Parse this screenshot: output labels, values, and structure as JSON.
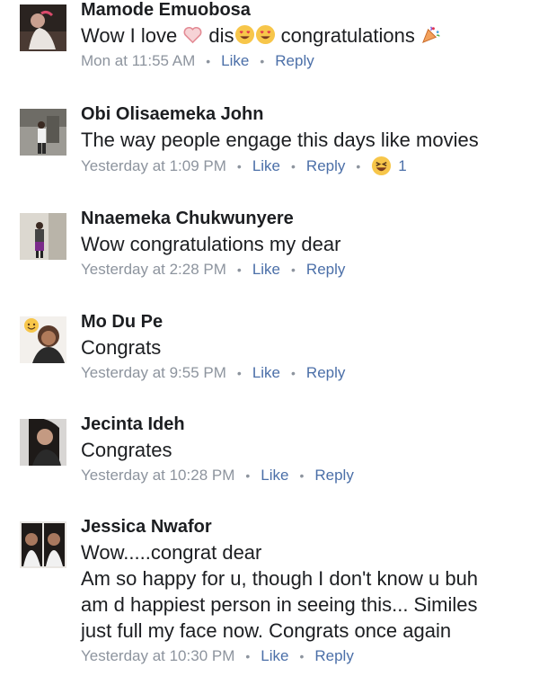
{
  "comments": [
    {
      "name": "Mamode Emuobosa",
      "text_parts": [
        "Wow I love ",
        " dis",
        " congratulations "
      ],
      "time": "Mon at 11:55 AM",
      "like": "Like",
      "reply": "Reply",
      "emoji": [
        "heart-icon",
        "heart-eyes-icon",
        "heart-eyes-icon",
        "party-popper-icon"
      ]
    },
    {
      "name": "Obi Olisaemeka John",
      "text": "The way people engage this days like movies",
      "time": "Yesterday at 1:09 PM",
      "like": "Like",
      "reply": "Reply",
      "reaction_icon": "laughing-icon",
      "reaction_count": "1"
    },
    {
      "name": "Nnaemeka Chukwunyere",
      "text": "Wow congratulations my dear",
      "time": "Yesterday at 2:28 PM",
      "like": "Like",
      "reply": "Reply"
    },
    {
      "name": "Mo Du Pe",
      "text": "Congrats",
      "time": "Yesterday at 9:55 PM",
      "like": "Like",
      "reply": "Reply"
    },
    {
      "name": "Jecinta Ideh",
      "text": "Congrates",
      "time": "Yesterday at 10:28 PM",
      "like": "Like",
      "reply": "Reply"
    },
    {
      "name": "Jessica Nwafor",
      "text_lines": [
        "Wow.....congrat dear",
        "Am so happy for u, though I don't know u buh",
        "am d happiest person in seeing this... Similes",
        "just full my face now. Congrats once again"
      ],
      "time": "Yesterday at 10:30 PM",
      "like": "Like",
      "reply": "Reply"
    }
  ],
  "colors": {
    "name": "#1c1e21",
    "meta": "#8d949e",
    "link": "#4b6fa8"
  }
}
